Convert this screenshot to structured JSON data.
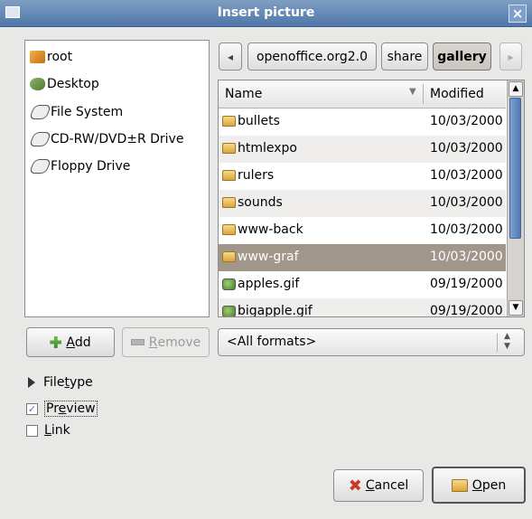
{
  "window": {
    "title": "Insert picture",
    "close_glyph": "×"
  },
  "places": [
    {
      "label": "root",
      "icon": "home-folder-icon"
    },
    {
      "label": "Desktop",
      "icon": "desktop-icon"
    },
    {
      "label": "File System",
      "icon": "drive-icon"
    },
    {
      "label": "CD-RW/DVD±R Drive",
      "icon": "cd-drive-icon"
    },
    {
      "label": "Floppy Drive",
      "icon": "floppy-drive-icon"
    }
  ],
  "place_buttons": {
    "add_label": "Add",
    "add_mnemonic": "A",
    "add_rest": "dd",
    "remove_mnemonic": "R",
    "remove_rest": "emove"
  },
  "path": {
    "back_glyph": "◂",
    "forward_glyph": "▸",
    "segments": [
      "openoffice.org2.0",
      "share",
      "gallery"
    ],
    "active_segment": "gallery"
  },
  "file_list": {
    "columns": {
      "name": "Name",
      "modified": "Modified"
    },
    "rows": [
      {
        "name": "bullets",
        "modified": "10/03/2000",
        "kind": "folder"
      },
      {
        "name": "htmlexpo",
        "modified": "10/03/2000",
        "kind": "folder"
      },
      {
        "name": "rulers",
        "modified": "10/03/2000",
        "kind": "folder"
      },
      {
        "name": "sounds",
        "modified": "10/03/2000",
        "kind": "folder"
      },
      {
        "name": "www-back",
        "modified": "10/03/2000",
        "kind": "folder"
      },
      {
        "name": "www-graf",
        "modified": "10/03/2000",
        "kind": "folder",
        "selected": true
      },
      {
        "name": "apples.gif",
        "modified": "09/19/2000",
        "kind": "image"
      },
      {
        "name": "bigapple.gif",
        "modified": "09/19/2000",
        "kind": "image"
      }
    ]
  },
  "filter": {
    "selected": "<All formats>"
  },
  "options": {
    "file_type": "File type",
    "file_type_mn_pre": "File ",
    "file_type_mn": "t",
    "file_type_mn_post": "ype",
    "preview_pre": "Pr",
    "preview_mn": "e",
    "preview_post": "view",
    "preview_checked": true,
    "link_mn": "L",
    "link_post": "ink",
    "link_checked": false
  },
  "actions": {
    "cancel_mn": "C",
    "cancel_rest": "ancel",
    "open_mn": "O",
    "open_rest": "pen"
  },
  "colors": {
    "selection": "#a09689",
    "titlebar": "#5b80ae",
    "scroll_thumb": "#5d86bd"
  }
}
